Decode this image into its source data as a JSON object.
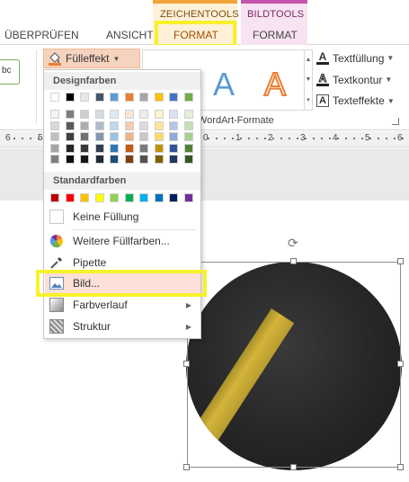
{
  "tabs": {
    "ueberpruefen": "ÜBERPRÜFEN",
    "ansicht": "ANSICHT",
    "zeichentools_context": "ZEICHENTOOLS",
    "zeichentools_format": "FORMAT",
    "bildtools_context": "BILDTOOLS",
    "bildtools_format": "FORMAT"
  },
  "ribbon": {
    "abc_label": "bc",
    "fill_button": "Fülleffekt",
    "wordart_letter": "A",
    "wordart_group": "WordArt-Formate",
    "text_fill": "Textfüllung",
    "text_outline": "Textkontur",
    "text_effects": "Texteffekte"
  },
  "ruler": {
    "left": [
      "6",
      "5"
    ],
    "right": [
      "0",
      "1",
      "2",
      "3",
      "4",
      "5",
      "6"
    ]
  },
  "menu": {
    "theme_header": "Designfarben",
    "standard_header": "Standardfarben",
    "theme_colors": [
      "#ffffff",
      "#000000",
      "#e7e6e6",
      "#44546a",
      "#5b9bd5",
      "#ed7d31",
      "#a5a5a5",
      "#ffc000",
      "#4472c4",
      "#70ad47"
    ],
    "theme_shades": [
      [
        "#f2f2f2",
        "#7f7f7f",
        "#d0cece",
        "#d6dce4",
        "#deeaf6",
        "#fbe5d5",
        "#ededed",
        "#fff2cc",
        "#dae3f3",
        "#e2efd9"
      ],
      [
        "#d8d8d8",
        "#595959",
        "#aeabab",
        "#adb9ca",
        "#bdd7ee",
        "#f7cbac",
        "#dbdbdb",
        "#fee599",
        "#b4c6e7",
        "#c5e0b3"
      ],
      [
        "#bfbfbf",
        "#3f3f3f",
        "#757070",
        "#8496b0",
        "#9cc3e5",
        "#f4b183",
        "#c9c9c9",
        "#ffd966",
        "#8eaadb",
        "#a8d08d"
      ],
      [
        "#a5a5a5",
        "#262626",
        "#3a3838",
        "#323f4f",
        "#2e75b5",
        "#c55a11",
        "#7b7b7b",
        "#bf9000",
        "#2f5496",
        "#538135"
      ],
      [
        "#7f7f7f",
        "#0c0c0c",
        "#171616",
        "#222a35",
        "#1e4e79",
        "#833c0b",
        "#525252",
        "#7f6000",
        "#1f3864",
        "#375623"
      ]
    ],
    "standard_colors": [
      "#c00000",
      "#ff0000",
      "#ffc000",
      "#ffff00",
      "#92d050",
      "#00b050",
      "#00b0f0",
      "#0070c0",
      "#002060",
      "#7030a0"
    ],
    "no_fill": "Keine Füllung",
    "more_colors": "Weitere Füllfarben...",
    "pipette": "Pipette",
    "picture": "Bild...",
    "gradient": "Farbverlauf",
    "texture": "Struktur"
  },
  "icons": {
    "fill": "paint-bucket-icon",
    "text_fill": "text-fill-icon",
    "more_colors": "color-wheel-icon",
    "pipette": "eyedropper-icon",
    "picture": "picture-icon",
    "gradient": "gradient-icon",
    "texture": "texture-icon",
    "rotate": "rotate-handle-icon"
  },
  "colors": {
    "highlight": "#f7f22a",
    "format_tab_text": "#a34c00",
    "zeichentools_accent": "#f2a33a",
    "bildtools_accent": "#c454ad"
  }
}
